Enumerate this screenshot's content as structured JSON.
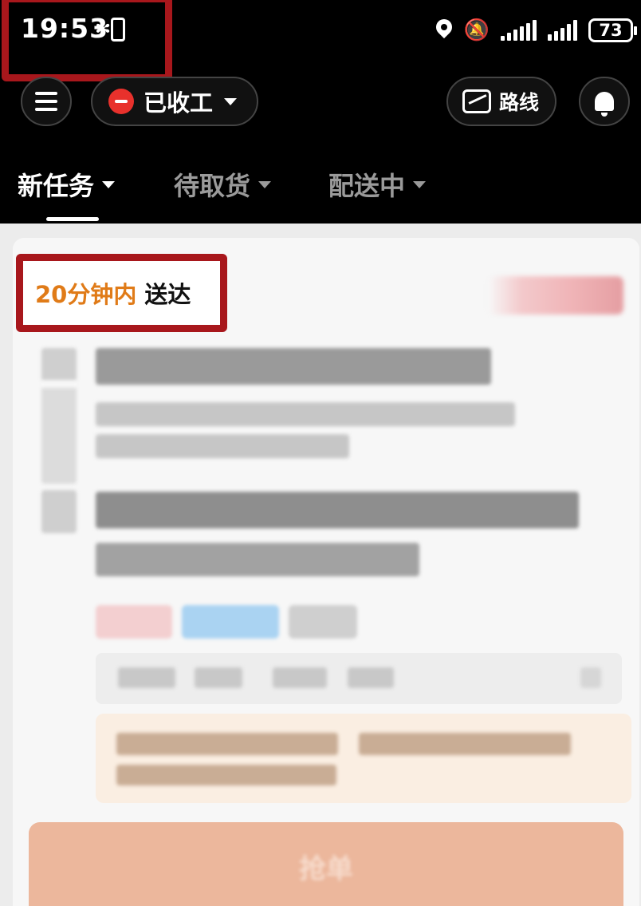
{
  "status_bar": {
    "time": "19:53",
    "battery": "73",
    "bluetooth_glyph": "✻",
    "mute_glyph": "🔕"
  },
  "top_bar": {
    "work_status": "已收工",
    "route_label": "路线",
    "icons": [
      "menu-icon",
      "stop-icon",
      "map-icon",
      "bell-icon"
    ]
  },
  "tabs": [
    {
      "label": "新任务",
      "active": true
    },
    {
      "label": "待取货",
      "active": false
    },
    {
      "label": "配送中",
      "active": false
    }
  ],
  "order_card": {
    "eta_time": "20分钟内",
    "eta_text": "送达",
    "accept_button_label": "抢单"
  },
  "colors": {
    "highlight_border": "#a8171c",
    "eta_orange": "#e07b18",
    "stop_red": "#e8312c",
    "accept_button": "#ecb79c"
  }
}
